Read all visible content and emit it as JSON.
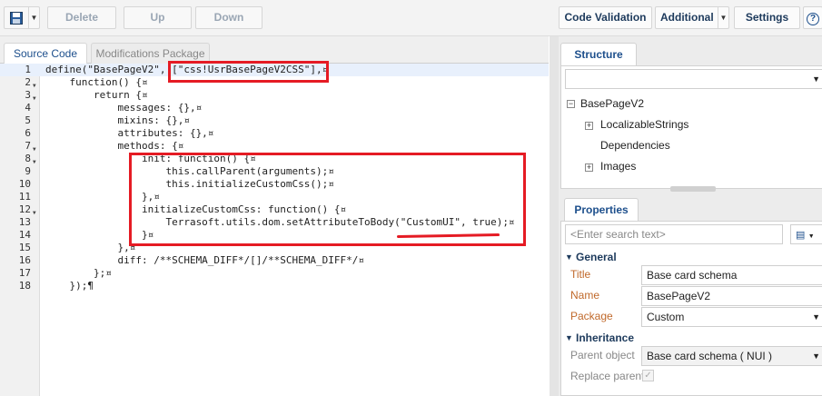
{
  "toolbar": {
    "delete_label": "Delete",
    "up_label": "Up",
    "down_label": "Down",
    "code_validation_label": "Code Validation",
    "additional_label": "Additional",
    "settings_label": "Settings",
    "help_label": "?"
  },
  "editor_tabs": [
    {
      "label": "Source Code",
      "active": true
    },
    {
      "label": "Modifications Package",
      "active": false
    }
  ],
  "code_lines": [
    {
      "n": "1",
      "text": "define(\"BasePageV2\", [\"css!UsrBasePageV2CSS\"],¤"
    },
    {
      "n": "2",
      "text": "    function() {¤"
    },
    {
      "n": "3",
      "text": "        return {¤"
    },
    {
      "n": "4",
      "text": "            messages: {},¤"
    },
    {
      "n": "5",
      "text": "            mixins: {},¤"
    },
    {
      "n": "6",
      "text": "            attributes: {},¤"
    },
    {
      "n": "7",
      "text": "            methods: {¤"
    },
    {
      "n": "8",
      "text": "                init: function() {¤"
    },
    {
      "n": "9",
      "text": "                    this.callParent(arguments);¤"
    },
    {
      "n": "10",
      "text": "                    this.initializeCustomCss();¤"
    },
    {
      "n": "11",
      "text": "                },¤"
    },
    {
      "n": "12",
      "text": "                initializeCustomCss: function() {¤"
    },
    {
      "n": "13",
      "text": "                    Terrasoft.utils.dom.setAttributeToBody(\"CustomUI\", true);¤"
    },
    {
      "n": "14",
      "text": "                }¤"
    },
    {
      "n": "15",
      "text": "            },¤"
    },
    {
      "n": "16",
      "text": "            diff: /**SCHEMA_DIFF*/[]/**SCHEMA_DIFF*/¤"
    },
    {
      "n": "17",
      "text": "        };¤"
    },
    {
      "n": "18",
      "text": "    });¶"
    }
  ],
  "structure": {
    "tab_label": "Structure",
    "root": "BasePageV2",
    "children": [
      "LocalizableStrings",
      "Dependencies",
      "Images"
    ]
  },
  "properties": {
    "tab_label": "Properties",
    "search_placeholder": "<Enter search text>",
    "general_label": "General",
    "title_label": "Title",
    "title_value": "Base card schema",
    "name_label": "Name",
    "name_value": "BasePageV2",
    "package_label": "Package",
    "package_value": "Custom",
    "inheritance_label": "Inheritance",
    "parent_label": "Parent object",
    "parent_value": "Base card schema ( NUI )",
    "replace_parent_label": "Replace parent"
  },
  "colors": {
    "highlight_red": "#e51b24",
    "accent_blue": "#1d4f8c"
  }
}
